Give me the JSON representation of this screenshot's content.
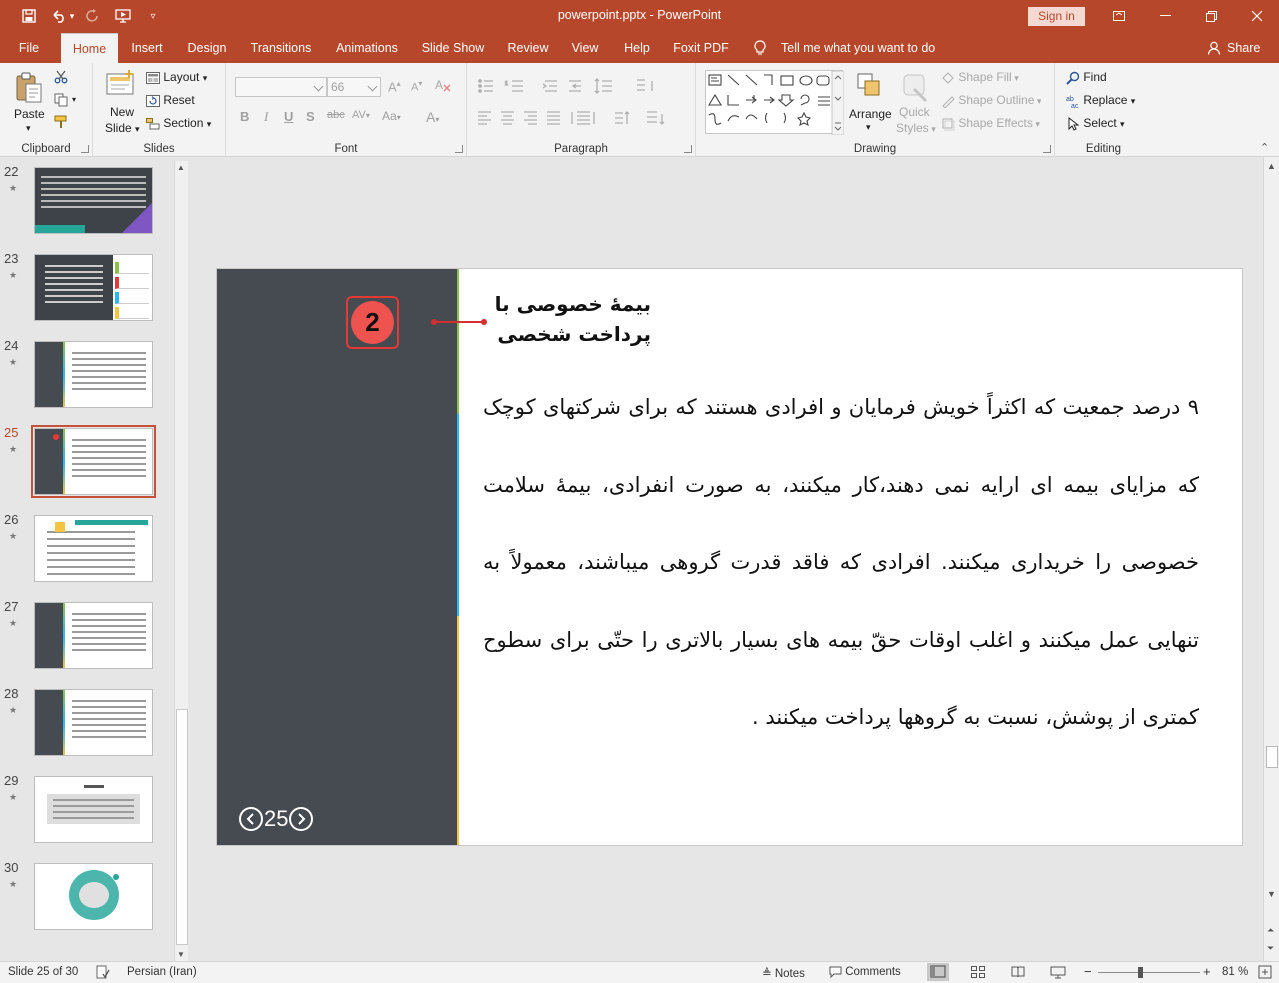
{
  "titlebar": {
    "doc_title": "powerpoint.pptx  -  PowerPoint",
    "signin": "Sign in"
  },
  "tabs": [
    "File",
    "Home",
    "Insert",
    "Design",
    "Transitions",
    "Animations",
    "Slide Show",
    "Review",
    "View",
    "Help",
    "Foxit PDF"
  ],
  "active_tab": "Home",
  "tell_me": "Tell me what you want to do",
  "share": "Share",
  "ribbon": {
    "clipboard": {
      "label": "Clipboard",
      "paste": "Paste"
    },
    "slides": {
      "label": "Slides",
      "new_slide_1": "New",
      "new_slide_2": "Slide",
      "layout": "Layout",
      "reset": "Reset",
      "section": "Section"
    },
    "font": {
      "label": "Font",
      "size": "66"
    },
    "paragraph": {
      "label": "Paragraph"
    },
    "drawing": {
      "label": "Drawing",
      "arrange": "Arrange",
      "quick_styles_1": "Quick",
      "quick_styles_2": "Styles",
      "shape_fill": "Shape Fill",
      "shape_outline": "Shape Outline",
      "shape_effects": "Shape Effects"
    },
    "editing": {
      "label": "Editing",
      "find": "Find",
      "replace": "Replace",
      "select": "Select"
    }
  },
  "thumbnails": [
    {
      "num": "22",
      "style": "dark"
    },
    {
      "num": "23",
      "style": "diagram"
    },
    {
      "num": "24",
      "style": "split"
    },
    {
      "num": "25",
      "style": "split",
      "active": true
    },
    {
      "num": "26",
      "style": "table"
    },
    {
      "num": "27",
      "style": "split"
    },
    {
      "num": "28",
      "style": "split"
    },
    {
      "num": "29",
      "style": "sources"
    },
    {
      "num": "30",
      "style": "end"
    }
  ],
  "slide": {
    "badge_number": "2",
    "heading": "بیمۀ خصوصی با پرداخت شخصی",
    "body": "۹ درصد جمعیت که اکثراً خویش فرمایان و افرادی هستند که برای شرکتهای کوچک که مزایای بیمه ای ارایه نمی دهند،کار میکنند، به صورت انفرادی، بیمۀ سلامت خصوصی را خریداری میکنند. افرادی که فاقد قدرت گروهی میباشند، معمولاً به تنهایی عمل میکنند و اغلب اوقات حقّ بیمه های بسیار بالاتری را حتّی برای سطوح کمتری از پوشش، نسبت به گروهها پرداخت میکنند .",
    "page_number": "25"
  },
  "statusbar": {
    "slide_info": "Slide 25 of 30",
    "language": "Persian (Iran)",
    "notes": "Notes",
    "comments": "Comments",
    "zoom": "81 %",
    "zoom_level": 0.81
  }
}
